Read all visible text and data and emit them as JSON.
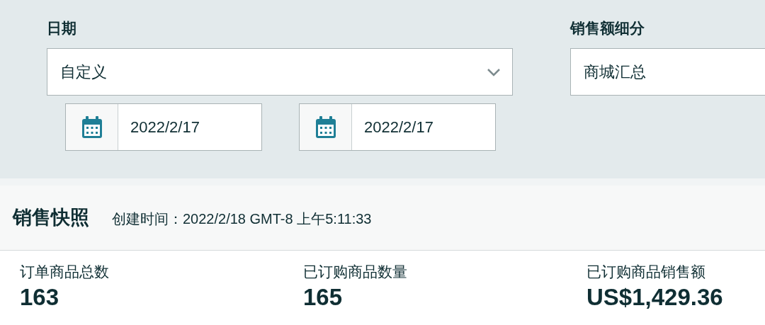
{
  "filters": [
    {
      "kind": "date",
      "label": "日期",
      "value": "自定义",
      "ranges": [
        {
          "value": "2022/2/17"
        },
        {
          "value": "2022/2/17"
        }
      ]
    },
    {
      "kind": "plain",
      "label": "销售额细分",
      "value": "商城汇总"
    }
  ],
  "snapshot": {
    "title": "销售快照",
    "created": "创建时间：2022/2/18 GMT-8 上午5:11:33"
  },
  "metrics": [
    {
      "label": "订单商品总数",
      "value": "163"
    },
    {
      "label": "已订购商品数量",
      "value": "165"
    },
    {
      "label": "已订购商品销售额",
      "value": "US$1,429.36"
    }
  ]
}
